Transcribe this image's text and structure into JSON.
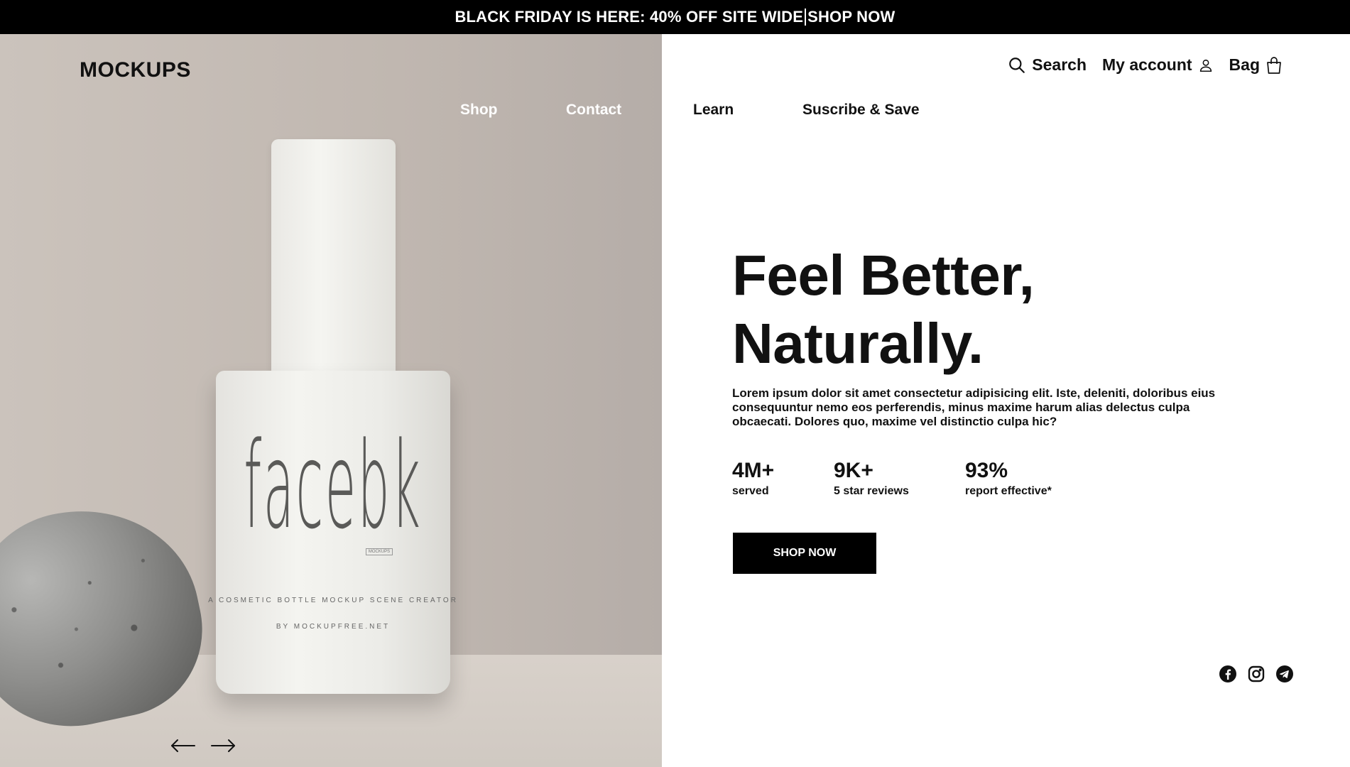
{
  "promo": {
    "text": "BLACK FRIDAY IS HERE: 40% OFF SITE WIDE",
    "link": "SHOP NOW"
  },
  "brand": {
    "logo": "MOCKUPS"
  },
  "nav": {
    "items": [
      {
        "label": "Shop"
      },
      {
        "label": "Contact"
      },
      {
        "label": "Learn"
      },
      {
        "label": "Suscribe & Save"
      }
    ]
  },
  "utility": {
    "search_label": "Search",
    "account_label": "My account",
    "bag_label": "Bag",
    "icons": [
      "search-icon",
      "user-icon",
      "bag-icon"
    ]
  },
  "product": {
    "brand": "facebk",
    "small_mark": "MOCKUPS",
    "tagline": "A COSMETIC BOTTLE MOCKUP SCENE CREATOR",
    "by": "BY MOCKUPFREE.NET"
  },
  "hero": {
    "headline_line1": "Feel Better,",
    "headline_line2": "Naturally.",
    "description": "Lorem ipsum dolor sit amet consectetur adipisicing elit. Iste, deleniti, doloribus eius consequuntur nemo eos perferendis, minus maxime harum alias delectus culpa obcaecati. Dolores quo, maxime vel distinctio culpa hic?",
    "cta_label": "SHOP NOW"
  },
  "stats": [
    {
      "value": "4M+",
      "label": "served"
    },
    {
      "value": "9K+",
      "label": "5 star reviews"
    },
    {
      "value": "93%",
      "label": "report effective*"
    }
  ],
  "carousel": {
    "icons": [
      "arrow-left-icon",
      "arrow-right-icon"
    ]
  },
  "socials": {
    "icons": [
      "facebook-icon",
      "instagram-icon",
      "telegram-icon"
    ]
  },
  "colors": {
    "accent": "#000000",
    "background": "#ffffff",
    "hero_bg": "#c4bcb5"
  }
}
